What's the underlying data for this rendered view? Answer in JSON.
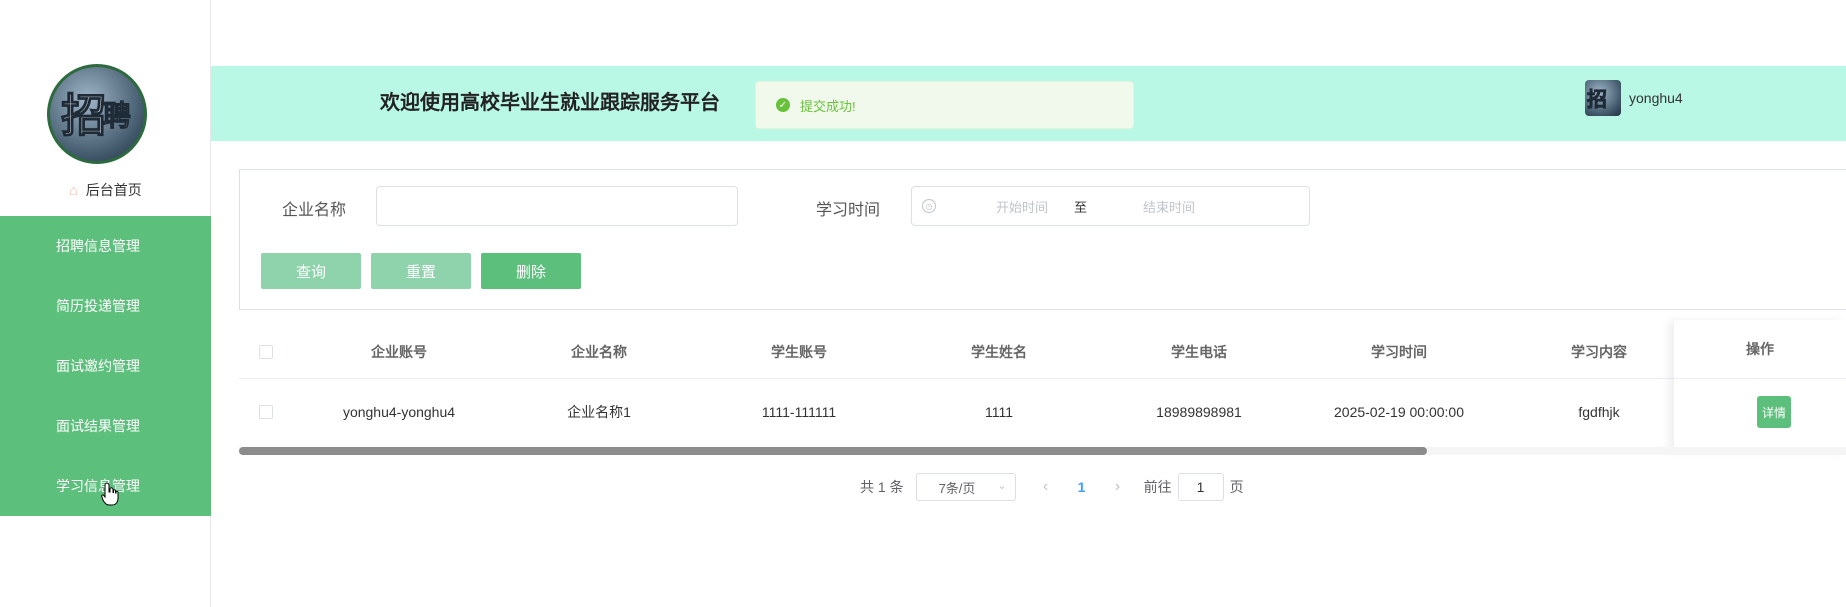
{
  "sidebar": {
    "logo_alt": "招聘",
    "home_label": "后台首页",
    "items": [
      {
        "label": "招聘信息管理"
      },
      {
        "label": "简历投递管理"
      },
      {
        "label": "面试邀约管理"
      },
      {
        "label": "面试结果管理"
      },
      {
        "label": "学习信息管理"
      }
    ]
  },
  "header": {
    "title": "欢迎使用高校毕业生就业跟踪服务平台",
    "toast": "提交成功!",
    "username": "yonghu4"
  },
  "search": {
    "company_label": "企业名称",
    "company_value": "",
    "time_label": "学习时间",
    "start_placeholder": "开始时间",
    "range_sep": "至",
    "end_placeholder": "结束时间",
    "query_btn": "查询",
    "reset_btn": "重置",
    "delete_btn": "删除"
  },
  "table": {
    "columns": [
      "企业账号",
      "企业名称",
      "学生账号",
      "学生姓名",
      "学生电话",
      "学习时间",
      "学习内容",
      "操作"
    ],
    "rows": [
      [
        "yonghu4-yonghu4",
        "企业名称1",
        "1111-111111",
        "1111",
        "18989898981",
        "2025-02-19 00:00:00",
        "fgdfhjk"
      ]
    ],
    "detail_btn": "详情"
  },
  "pagination": {
    "total": "共 1 条",
    "page_size": "7条/页",
    "current_page": "1",
    "goto_label": "前往",
    "goto_value": "1",
    "page_suffix": "页"
  },
  "colors": {
    "accent": "#5cbf7c",
    "header_bg": "#baf8e6",
    "success": "#67c23a"
  }
}
